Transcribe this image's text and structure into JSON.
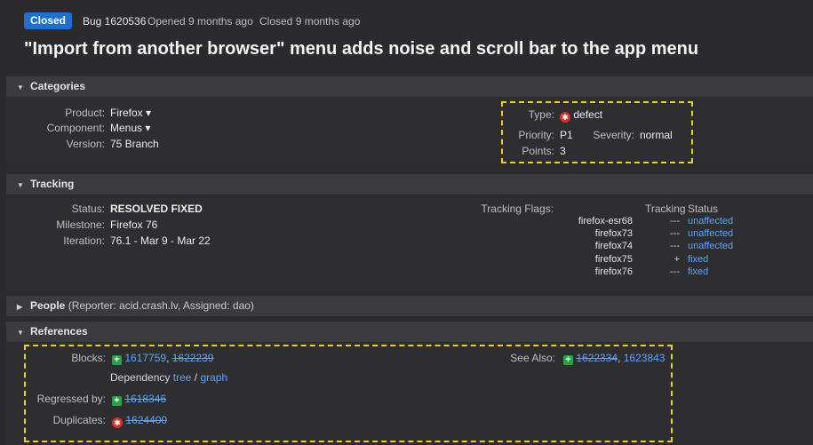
{
  "header": {
    "status_badge": "Closed",
    "bug_id": "Bug 1620536",
    "opened": "Opened 9 months ago",
    "closed": "Closed 9 months ago",
    "title": "\"Import from another browser\" menu adds noise and scroll bar to the app menu"
  },
  "categories": {
    "heading": "Categories",
    "product_label": "Product:",
    "product_value": "Firefox ▾",
    "component_label": "Component:",
    "component_value": "Menus ▾",
    "version_label": "Version:",
    "version_value": "75 Branch",
    "type_label": "Type:",
    "type_value": "defect",
    "priority_label": "Priority:",
    "priority_value": "P1",
    "severity_label": "Severity:",
    "severity_value": "normal",
    "points_label": "Points:",
    "points_value": "3"
  },
  "tracking": {
    "heading": "Tracking",
    "status_label": "Status:",
    "status_value": "RESOLVED FIXED",
    "milestone_label": "Milestone:",
    "milestone_value": "Firefox 76",
    "iteration_label": "Iteration:",
    "iteration_value": "76.1 - Mar 9 - Mar 22",
    "flags_label": "Tracking Flags:",
    "col_tracking": "Tracking",
    "col_status": "Status",
    "flags": [
      {
        "name": "firefox-esr68",
        "tracking": "---",
        "status": "unaffected"
      },
      {
        "name": "firefox73",
        "tracking": "---",
        "status": "unaffected"
      },
      {
        "name": "firefox74",
        "tracking": "---",
        "status": "unaffected"
      },
      {
        "name": "firefox75",
        "tracking": "+",
        "status": "fixed"
      },
      {
        "name": "firefox76",
        "tracking": "---",
        "status": "fixed"
      }
    ]
  },
  "people": {
    "heading": "People",
    "summary": "(Reporter: acid.crash.lv, Assigned: dao)"
  },
  "references": {
    "heading": "References",
    "blocks_label": "Blocks:",
    "blocks": [
      "1617759",
      "1622239"
    ],
    "dependency_label": "Dependency",
    "tree_link": "tree",
    "slash": "/",
    "graph_link": "graph",
    "see_also_label": "See Also:",
    "see_also": [
      "1622334",
      "1623843"
    ],
    "regressed_label": "Regressed by:",
    "regressed": "1618346",
    "duplicates_label": "Duplicates:",
    "duplicates": "1624400",
    "comma": ","
  },
  "colors": {
    "background": "#2b2b2d",
    "accent": "#1f6fcf",
    "link": "#59a5ff",
    "highlight": "#e8d21a",
    "green_icon": "#2ea043",
    "red_icon": "#e02c2c"
  }
}
